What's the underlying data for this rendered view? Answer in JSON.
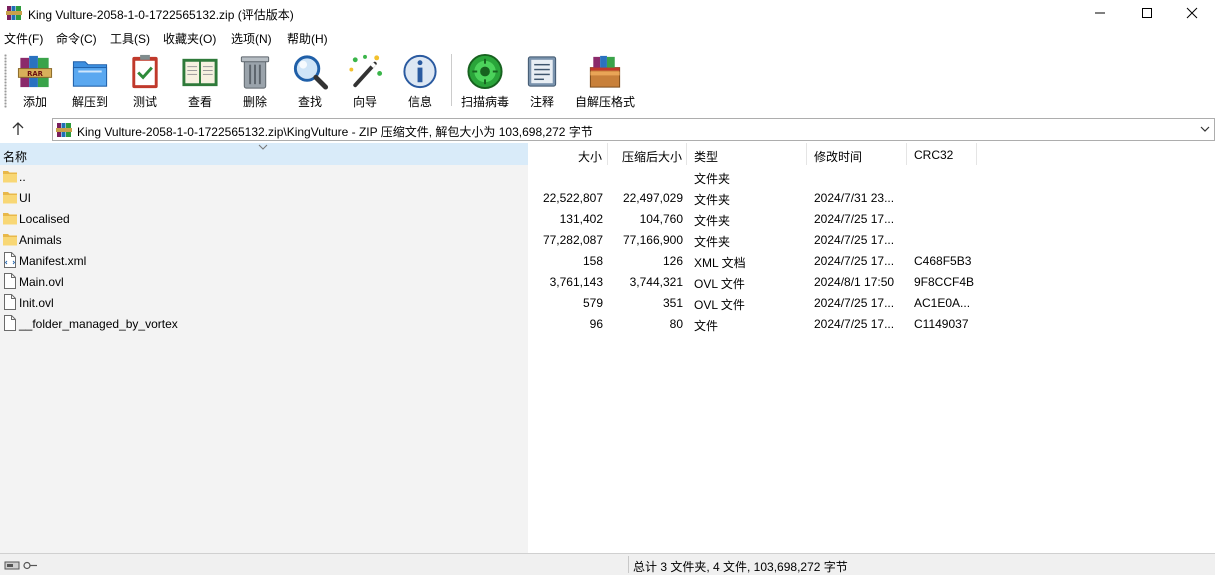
{
  "window": {
    "title": "King Vulture-2058-1-0-1722565132.zip (评估版本)",
    "minimize_icon": "minimize-icon",
    "maximize_icon": "maximize-icon",
    "close_icon": "close-icon"
  },
  "menu": [
    "文件(F)",
    "命令(C)",
    "工具(S)",
    "收藏夹(O)",
    "选项(N)",
    "帮助(H)"
  ],
  "toolbar": [
    {
      "label": "添加",
      "icon": "winrar-books-icon"
    },
    {
      "label": "解压到",
      "icon": "folder-extract-icon"
    },
    {
      "label": "测试",
      "icon": "clipboard-check-icon"
    },
    {
      "label": "查看",
      "icon": "open-book-icon"
    },
    {
      "label": "删除",
      "icon": "trash-can-icon"
    },
    {
      "label": "查找",
      "icon": "magnifier-icon"
    },
    {
      "label": "向导",
      "icon": "magic-wand-icon"
    },
    {
      "label": "信息",
      "icon": "info-icon"
    },
    {
      "label": "扫描病毒",
      "icon": "virus-scan-icon"
    },
    {
      "label": "注释",
      "icon": "comment-icon"
    },
    {
      "label": "自解压格式",
      "icon": "sfx-box-icon"
    }
  ],
  "address": {
    "up_icon": "up-arrow-icon",
    "path": "King Vulture-2058-1-0-1722565132.zip\\KingVulture - ZIP 压缩文件, 解包大小为 103,698,272 字节"
  },
  "columns": {
    "name": "名称",
    "size": "大小",
    "packed": "压缩后大小",
    "type": "类型",
    "modified": "修改时间",
    "crc": "CRC32"
  },
  "files": [
    {
      "name": "..",
      "size": "",
      "packed": "",
      "type": "文件夹",
      "modified": "",
      "crc": "",
      "icon": "folder-icon"
    },
    {
      "name": "UI",
      "size": "22,522,807",
      "packed": "22,497,029",
      "type": "文件夹",
      "modified": "2024/7/31 23...",
      "crc": "",
      "icon": "folder-icon"
    },
    {
      "name": "Localised",
      "size": "131,402",
      "packed": "104,760",
      "type": "文件夹",
      "modified": "2024/7/25 17...",
      "crc": "",
      "icon": "folder-icon"
    },
    {
      "name": "Animals",
      "size": "77,282,087",
      "packed": "77,166,900",
      "type": "文件夹",
      "modified": "2024/7/25 17...",
      "crc": "",
      "icon": "folder-icon"
    },
    {
      "name": "Manifest.xml",
      "size": "158",
      "packed": "126",
      "type": "XML 文档",
      "modified": "2024/7/25 17...",
      "crc": "C468F5B3",
      "icon": "xml-file-icon"
    },
    {
      "name": "Main.ovl",
      "size": "3,761,143",
      "packed": "3,744,321",
      "type": "OVL 文件",
      "modified": "2024/8/1 17:50",
      "crc": "9F8CCF4B",
      "icon": "file-icon"
    },
    {
      "name": "Init.ovl",
      "size": "579",
      "packed": "351",
      "type": "OVL 文件",
      "modified": "2024/7/25 17...",
      "crc": "AC1E0A...",
      "icon": "file-icon"
    },
    {
      "name": "__folder_managed_by_vortex",
      "size": "96",
      "packed": "80",
      "type": "文件",
      "modified": "2024/7/25 17...",
      "crc": "C1149037",
      "icon": "file-icon"
    }
  ],
  "status": {
    "left_icons": [
      "drive-icon",
      "key-icon"
    ],
    "summary": "总计 3 文件夹, 4 文件, 103,698,272 字节"
  },
  "colors": {
    "selected_header": "#d9ebf9",
    "name_column_bg": "#f3f3f3",
    "folder_yellow": "#f8d775"
  }
}
